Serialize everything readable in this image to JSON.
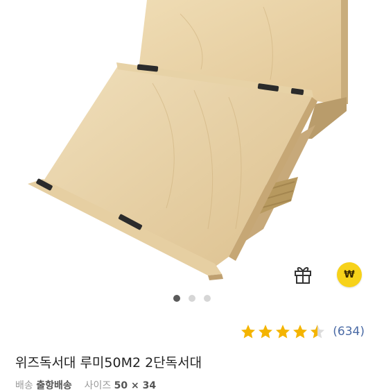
{
  "product": {
    "title": "위즈독서대 루미50M2 2단독서대",
    "rating": 4.5,
    "review_count": "(634)",
    "image_index": 1,
    "image_count": 3,
    "sub_row": {
      "label_1": "배송",
      "value_1": "출항배송",
      "label_2": "사이즈",
      "value_2": "50 × 34"
    }
  },
  "actions": {
    "gift_icon": "gift-icon",
    "won_icon": "won-coin-icon",
    "won_symbol": "₩"
  },
  "colors": {
    "star": "#f4b400",
    "link": "#4a6aa5",
    "coin": "#f7d21a",
    "wood": "#e8d3a8"
  }
}
